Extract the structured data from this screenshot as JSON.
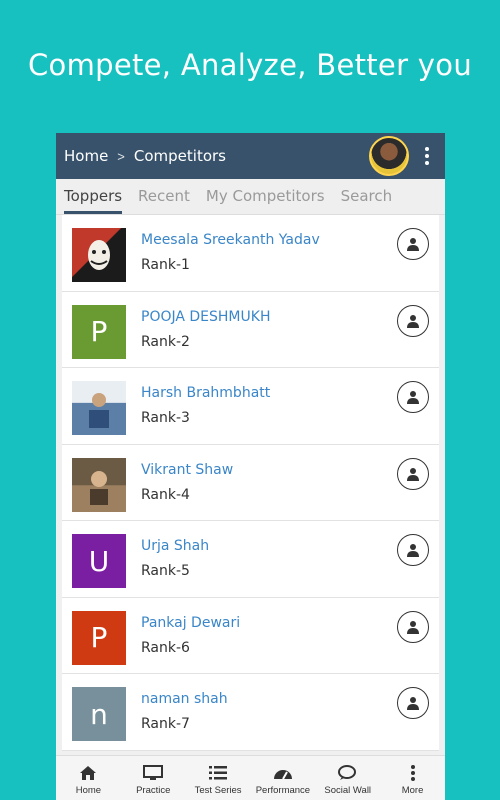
{
  "headline": "Compete, Analyze, Better you",
  "appbar": {
    "home": "Home",
    "separator": ">",
    "current": "Competitors"
  },
  "tabs": [
    {
      "label": "Toppers",
      "active": true
    },
    {
      "label": "Recent",
      "active": false
    },
    {
      "label": "My Competitors",
      "active": false
    },
    {
      "label": "Search",
      "active": false
    }
  ],
  "competitors": [
    {
      "name": "Meesala Sreekanth Yadav",
      "rank": "Rank-1",
      "avatar_type": "photo"
    },
    {
      "name": "POOJA DESHMUKH",
      "rank": "Rank-2",
      "initial": "P",
      "color": "#6a9a32"
    },
    {
      "name": "Harsh Brahmbhatt",
      "rank": "Rank-3",
      "avatar_type": "photo"
    },
    {
      "name": "Vikrant Shaw",
      "rank": "Rank-4",
      "avatar_type": "photo"
    },
    {
      "name": "Urja Shah",
      "rank": "Rank-5",
      "initial": "U",
      "color": "#7b1fa2"
    },
    {
      "name": "Pankaj Dewari",
      "rank": "Rank-6",
      "initial": "P",
      "color": "#cf3a13"
    },
    {
      "name": "naman shah",
      "rank": "Rank-7",
      "initial": "n",
      "color": "#78909c"
    }
  ],
  "bottom_nav": [
    {
      "label": "Home",
      "icon": "home-icon"
    },
    {
      "label": "Practice",
      "icon": "monitor-icon"
    },
    {
      "label": "Test Series",
      "icon": "list-icon"
    },
    {
      "label": "Performance",
      "icon": "gauge-icon"
    },
    {
      "label": "Social Wall",
      "icon": "chat-icon"
    },
    {
      "label": "More",
      "icon": "more-vertical-icon"
    }
  ]
}
